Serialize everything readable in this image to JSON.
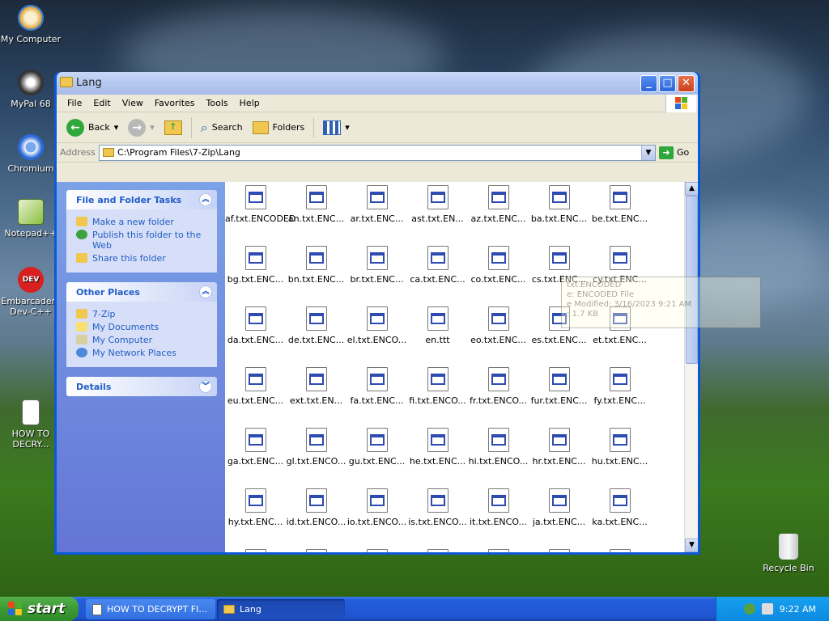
{
  "desktop": {
    "icons": [
      {
        "label": "My Computer"
      },
      {
        "label": "MyPal 68"
      },
      {
        "label": "Chromium"
      },
      {
        "label": "Notepad++"
      },
      {
        "label": "Embarcadero Dev-C++"
      },
      {
        "label": "HOW TO DECRY..."
      },
      {
        "label": "Recycle Bin"
      }
    ]
  },
  "window": {
    "title": "Lang",
    "menu": [
      "File",
      "Edit",
      "View",
      "Favorites",
      "Tools",
      "Help"
    ],
    "toolbar": {
      "back": "Back",
      "search": "Search",
      "folders": "Folders"
    },
    "address": {
      "label": "Address",
      "path": "C:\\Program Files\\7-Zip\\Lang",
      "go": "Go"
    },
    "tasks": {
      "file_folder_title": "File and Folder Tasks",
      "file_folder_items": [
        "Make a new folder",
        "Publish this folder to the Web",
        "Share this folder"
      ],
      "other_places_title": "Other Places",
      "other_places_items": [
        "7-Zip",
        "My Documents",
        "My Computer",
        "My Network Places"
      ],
      "details_title": "Details"
    },
    "files": [
      "af.txt.ENCODED",
      "an.txt.ENC...",
      "ar.txt.ENC...",
      "ast.txt.EN...",
      "az.txt.ENC...",
      "ba.txt.ENC...",
      "be.txt.ENC...",
      "bg.txt.ENC...",
      "bn.txt.ENC...",
      "br.txt.ENC...",
      "ca.txt.ENC...",
      "co.txt.ENC...",
      "cs.txt.ENC...",
      "cy.txt.ENC...",
      "da.txt.ENC...",
      "de.txt.ENC...",
      "el.txt.ENCO...",
      "en.ttt",
      "eo.txt.ENC...",
      "es.txt.ENC...",
      "et.txt.ENC...",
      "eu.txt.ENC...",
      "ext.txt.EN...",
      "fa.txt.ENC...",
      "fi.txt.ENCO...",
      "fr.txt.ENCO...",
      "fur.txt.ENC...",
      "fy.txt.ENC...",
      "ga.txt.ENC...",
      "gl.txt.ENCO...",
      "gu.txt.ENC...",
      "he.txt.ENC...",
      "hi.txt.ENCO...",
      "hr.txt.ENC...",
      "hu.txt.ENC...",
      "hy.txt.ENC...",
      "id.txt.ENCO...",
      "io.txt.ENCO...",
      "is.txt.ENCO...",
      "it.txt.ENCO...",
      "ja.txt.ENC...",
      "ka.txt.ENC...",
      "",
      "",
      "",
      "",
      "",
      "",
      ""
    ],
    "tooltip": {
      "line1": "txt.ENCODED",
      "line2": "e: ENCODED File",
      "line3": "e Modified: 3/16/2023 9:21 AM",
      "line4": ": 1.7 KB"
    }
  },
  "taskbar": {
    "start": "start",
    "tasks": [
      "HOW TO DECRYPT FI...",
      "Lang"
    ],
    "clock": "9:22 AM"
  },
  "colors": {
    "xp_blue": "#0054e3",
    "start_green": "#3c9a34",
    "task_link": "#215dc6"
  }
}
